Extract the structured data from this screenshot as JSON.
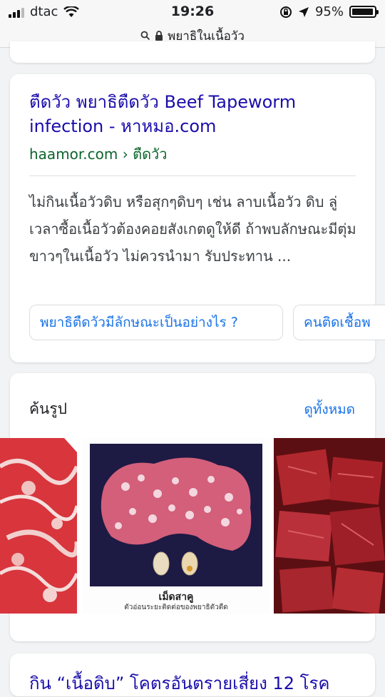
{
  "status_bar": {
    "carrier": "dtac",
    "time": "19:26",
    "battery": "95%"
  },
  "address_bar": {
    "query": "พยาธิในเนื้อวัว"
  },
  "result": {
    "title": "ตืดวัว พยาธิตืดวัว Beef Tapeworm infection - หาหมอ.com",
    "url": "haamor.com › ตืดวัว",
    "snippet": "ไม่กินเนื้อวัวดิบ หรือสุกๆดิบๆ เช่น ลาบเนื้อวัว ดิบ ลู่ เวลาซื้อเนื้อวัวต้องคอยสังเกตดูให้ดี ถ้าพบลักษณะมีตุ่มขาวๆในเนื้อวัว ไม่ควรนำมา รับประทาน ...",
    "chips": [
      "พยาธิตืดวัวมีลักษณะเป็นอย่างไร ?",
      "คนติดเชื้อพ"
    ]
  },
  "images_section": {
    "heading": "ค้นรูป",
    "see_all": "ดูทั้งหมด",
    "image2_caption": "เม็ดสาคู",
    "image2_subcaption": "ตัวอ่อนระยะติดต่อของพยาธิตัวตืด"
  },
  "next_result": {
    "title": "กิน “เนื้อดิบ” โคตรอันตรายเสี่ยง 12 โรค"
  },
  "colors": {
    "link": "#1a0dab",
    "url_green": "#0d652d",
    "accent_blue": "#1a73e8",
    "page_bg": "#f1f3f4"
  }
}
